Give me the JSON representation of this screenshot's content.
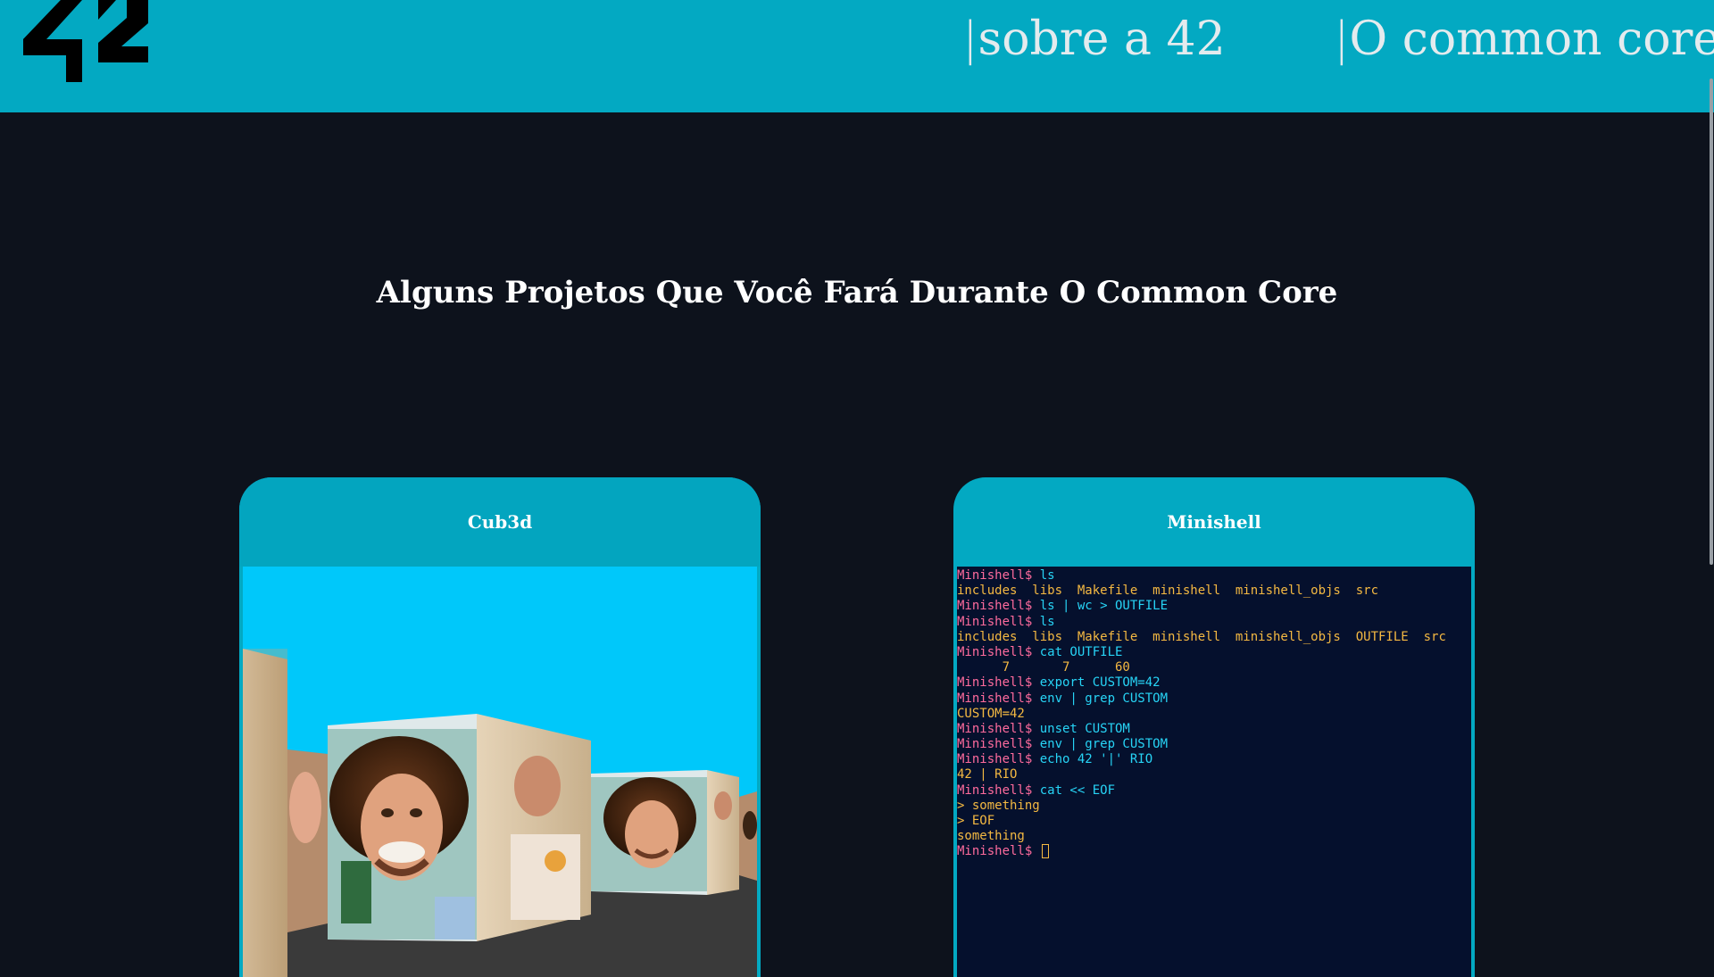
{
  "colors": {
    "header_bg": "#03a9c2",
    "page_bg": "#0d121c",
    "terminal_bg": "#05102d",
    "prompt": "#ff6b9d",
    "command": "#27d4f6",
    "output": "#f5b942",
    "sky": "#00c8fa",
    "floor": "#3a3a3a"
  },
  "header": {
    "logo_icon": "42-logo",
    "nav": [
      {
        "bar": "|",
        "label": "sobre a 42"
      },
      {
        "bar": "|",
        "label": "O common core"
      }
    ]
  },
  "main": {
    "section_title": "Alguns Projetos Que Você Fará Durante O Common Core"
  },
  "projects": [
    {
      "title": "Cub3d",
      "preview": "raycaster-scene"
    },
    {
      "title": "Minishell",
      "terminal": [
        {
          "prompt": "Minishell$ ",
          "cmd": "ls"
        },
        {
          "out": "includes  libs  Makefile  minishell  minishell_objs  src"
        },
        {
          "prompt": "Minishell$ ",
          "cmd": "ls | wc > OUTFILE"
        },
        {
          "prompt": "Minishell$ ",
          "cmd": "ls"
        },
        {
          "out": "includes  libs  Makefile  minishell  minishell_objs  OUTFILE  src"
        },
        {
          "prompt": "Minishell$ ",
          "cmd": "cat OUTFILE"
        },
        {
          "out": "      7       7      60"
        },
        {
          "prompt": "Minishell$ ",
          "cmd": "export CUSTOM=42"
        },
        {
          "prompt": "Minishell$ ",
          "cmd": "env | grep CUSTOM"
        },
        {
          "out": "CUSTOM=42"
        },
        {
          "prompt": "Minishell$ ",
          "cmd": "unset CUSTOM"
        },
        {
          "prompt": "Minishell$ ",
          "cmd": "env | grep CUSTOM"
        },
        {
          "prompt": "Minishell$ ",
          "cmd": "echo 42 '|' RIO"
        },
        {
          "out": "42 | RIO"
        },
        {
          "prompt": "Minishell$ ",
          "cmd": "cat << EOF"
        },
        {
          "out": "> something"
        },
        {
          "out": "> EOF"
        },
        {
          "out": "something"
        },
        {
          "prompt": "Minishell$ ",
          "cmd": "",
          "cursor": true
        }
      ]
    }
  ]
}
